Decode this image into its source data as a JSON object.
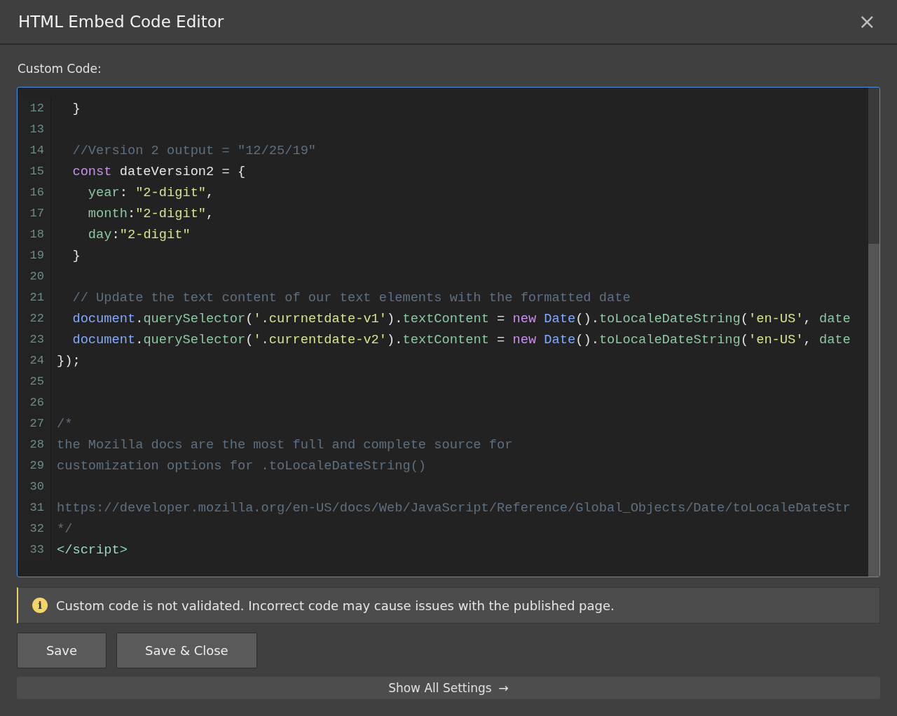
{
  "dialog": {
    "title": "HTML Embed Code Editor",
    "close_icon": "×"
  },
  "field_label": "Custom Code:",
  "code_lines": [
    {
      "number": "12",
      "tokens": [
        {
          "text": "  }",
          "kind": "plain"
        }
      ]
    },
    {
      "number": "13"
    },
    {
      "number": "14",
      "tokens": [
        {
          "text": "  //Version 2 output = \"12/25/19\"",
          "kind": "comment"
        }
      ]
    },
    {
      "number": "15",
      "tokens": [
        {
          "text": "  const",
          "kind": "keyword"
        },
        {
          "text": " dateVersion2 = {",
          "kind": "plain"
        }
      ]
    },
    {
      "number": "16",
      "tokens": [
        {
          "text": "    year",
          "kind": "prop"
        },
        {
          "text": ": ",
          "kind": "plain"
        },
        {
          "text": "\"2-digit\"",
          "kind": "string"
        },
        {
          "text": ",",
          "kind": "plain"
        }
      ]
    },
    {
      "number": "17",
      "tokens": [
        {
          "text": "    month",
          "kind": "prop"
        },
        {
          "text": ":",
          "kind": "plain"
        },
        {
          "text": "\"2-digit\"",
          "kind": "string"
        },
        {
          "text": ",",
          "kind": "plain"
        }
      ]
    },
    {
      "number": "18",
      "tokens": [
        {
          "text": "    day",
          "kind": "prop"
        },
        {
          "text": ":",
          "kind": "plain"
        },
        {
          "text": "\"2-digit\"",
          "kind": "string"
        }
      ]
    },
    {
      "number": "19",
      "tokens": [
        {
          "text": "  }",
          "kind": "plain"
        }
      ]
    },
    {
      "number": "20"
    },
    {
      "number": "21",
      "tokens": [
        {
          "text": "  // Update the text content of our text elements with the formatted date",
          "kind": "comment"
        }
      ]
    },
    {
      "number": "22",
      "tokens": [
        {
          "text": "  document",
          "kind": "builtin"
        },
        {
          "text": ".",
          "kind": "plain"
        },
        {
          "text": "querySelector",
          "kind": "prop"
        },
        {
          "text": "(",
          "kind": "plain"
        },
        {
          "text": "'.currnetdate-v1'",
          "kind": "string"
        },
        {
          "text": ").",
          "kind": "plain"
        },
        {
          "text": "textContent",
          "kind": "prop"
        },
        {
          "text": " = ",
          "kind": "plain"
        },
        {
          "text": "new",
          "kind": "keyword"
        },
        {
          "text": " Date",
          "kind": "builtin"
        },
        {
          "text": "().",
          "kind": "plain"
        },
        {
          "text": "toLocaleDateString",
          "kind": "prop"
        },
        {
          "text": "(",
          "kind": "plain"
        },
        {
          "text": "'en-US'",
          "kind": "string"
        },
        {
          "text": ", ",
          "kind": "plain"
        },
        {
          "text": "date",
          "kind": "prop"
        }
      ]
    },
    {
      "number": "23",
      "tokens": [
        {
          "text": "  document",
          "kind": "builtin"
        },
        {
          "text": ".",
          "kind": "plain"
        },
        {
          "text": "querySelector",
          "kind": "prop"
        },
        {
          "text": "(",
          "kind": "plain"
        },
        {
          "text": "'.currentdate-v2'",
          "kind": "string"
        },
        {
          "text": ").",
          "kind": "plain"
        },
        {
          "text": "textContent",
          "kind": "prop"
        },
        {
          "text": " = ",
          "kind": "plain"
        },
        {
          "text": "new",
          "kind": "keyword"
        },
        {
          "text": " Date",
          "kind": "builtin"
        },
        {
          "text": "().",
          "kind": "plain"
        },
        {
          "text": "toLocaleDateString",
          "kind": "prop"
        },
        {
          "text": "(",
          "kind": "plain"
        },
        {
          "text": "'en-US'",
          "kind": "string"
        },
        {
          "text": ", ",
          "kind": "plain"
        },
        {
          "text": "date",
          "kind": "prop"
        }
      ]
    },
    {
      "number": "24",
      "tokens": [
        {
          "text": "});",
          "kind": "plain"
        }
      ]
    },
    {
      "number": "25"
    },
    {
      "number": "26"
    },
    {
      "number": "27",
      "tokens": [
        {
          "text": "/*",
          "kind": "comment"
        }
      ]
    },
    {
      "number": "28",
      "tokens": [
        {
          "text": "the Mozilla docs are the most full and complete source for",
          "kind": "comment"
        }
      ]
    },
    {
      "number": "29",
      "tokens": [
        {
          "text": "customization options for .toLocaleDateString()",
          "kind": "comment"
        }
      ]
    },
    {
      "number": "30"
    },
    {
      "number": "31",
      "tokens": [
        {
          "text": "https://developer.mozilla.org/en-US/docs/Web/JavaScript/Reference/Global_Objects/Date/toLocaleDateStr",
          "kind": "comment"
        }
      ]
    },
    {
      "number": "32",
      "tokens": [
        {
          "text": "*/",
          "kind": "comment"
        }
      ]
    },
    {
      "number": "33",
      "tokens": [
        {
          "text": "</script>",
          "kind": "tag"
        }
      ]
    }
  ],
  "warning": {
    "icon": "i",
    "text": "Custom code is not validated. Incorrect code may cause issues with the published page."
  },
  "buttons": [
    "Save",
    "Save & Close"
  ],
  "show_all": {
    "label": "Show All Settings",
    "arrow": "→"
  }
}
